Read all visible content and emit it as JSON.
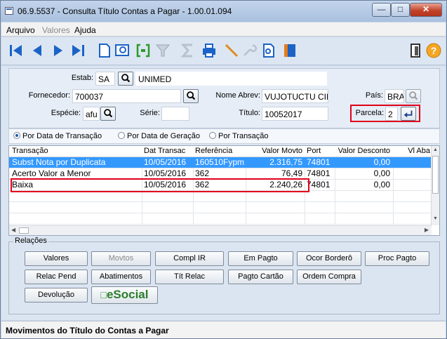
{
  "window": {
    "title": "06.9.5537 - Consulta Título Contas a Pagar - 1.00.01.094"
  },
  "menu": {
    "items": [
      {
        "label": "Arquivo",
        "enabled": true
      },
      {
        "label": "Valores",
        "enabled": false
      },
      {
        "label": "Ajuda",
        "enabled": true
      }
    ]
  },
  "toolbar": {
    "icons": [
      "first-icon",
      "prev-icon",
      "next-icon",
      "last-icon",
      "new-document-icon",
      "zoom-icon",
      "goto-icon",
      "filter-icon",
      "sum-icon",
      "print-icon",
      "edit-icon",
      "tools-icon",
      "preview-icon",
      "book-icon",
      "exit-icon",
      "help-icon"
    ]
  },
  "form": {
    "estab": {
      "label": "Estab:",
      "value": "SA",
      "desc": "UNIMED"
    },
    "fornecedor": {
      "label": "Fornecedor:",
      "value": "700037"
    },
    "nome_abrev": {
      "label": "Nome Abrev:",
      "value": "VUJOTUCTU CIMEA"
    },
    "pais": {
      "label": "País:",
      "value": "BRA"
    },
    "especie": {
      "label": "Espécie:",
      "value": "afu"
    },
    "serie": {
      "label": "Série:",
      "value": ""
    },
    "titulo": {
      "label": "Título:",
      "value": "10052017"
    },
    "parcela": {
      "label": "Parcela:",
      "value": "2"
    }
  },
  "radios": [
    {
      "label": "Por Data de Transação",
      "selected": true
    },
    {
      "label": "Por Data de Geração",
      "selected": false
    },
    {
      "label": "Por Transação",
      "selected": false
    }
  ],
  "grid": {
    "columns": [
      "Transação",
      "Dat Transac",
      "Referência",
      "Valor Movto",
      "Port",
      "Valor Desconto",
      "Vl Aba"
    ],
    "rows": [
      [
        "Subst Nota por Duplicata",
        "10/05/2016",
        "160510Fypm",
        "2.316,75",
        "74801",
        "0,00",
        ""
      ],
      [
        "Acerto Valor a Menor",
        "10/05/2016",
        "362",
        "76,49",
        "74801",
        "0,00",
        ""
      ],
      [
        "Baixa",
        "10/05/2016",
        "362",
        "2.240,26",
        "74801",
        "0,00",
        ""
      ]
    ],
    "selected_row": 0
  },
  "relacoes": {
    "title": "Relações",
    "buttons": [
      {
        "label": "Valores",
        "enabled": true
      },
      {
        "label": "Movtos",
        "enabled": false
      },
      {
        "label": "Compl IR",
        "enabled": true
      },
      {
        "label": "Em Pagto",
        "enabled": true
      },
      {
        "label": "Ocor Borderô",
        "enabled": true
      },
      {
        "label": "Proc Pagto",
        "enabled": true
      },
      {
        "label": "Relac Pend",
        "enabled": true
      },
      {
        "label": "Abatimentos",
        "enabled": true
      },
      {
        "label": "Tít Relac",
        "enabled": true
      },
      {
        "label": "Pagto Cartão",
        "enabled": true
      },
      {
        "label": "Ordem Compra",
        "enabled": true
      },
      {
        "label": "Devolução",
        "enabled": true
      },
      {
        "label": "eSocial",
        "enabled": true
      }
    ]
  },
  "status": {
    "text": "Movimentos do Título do Contas a Pagar"
  },
  "colors": {
    "highlight": "#e0001a",
    "selection": "#3399ff"
  }
}
